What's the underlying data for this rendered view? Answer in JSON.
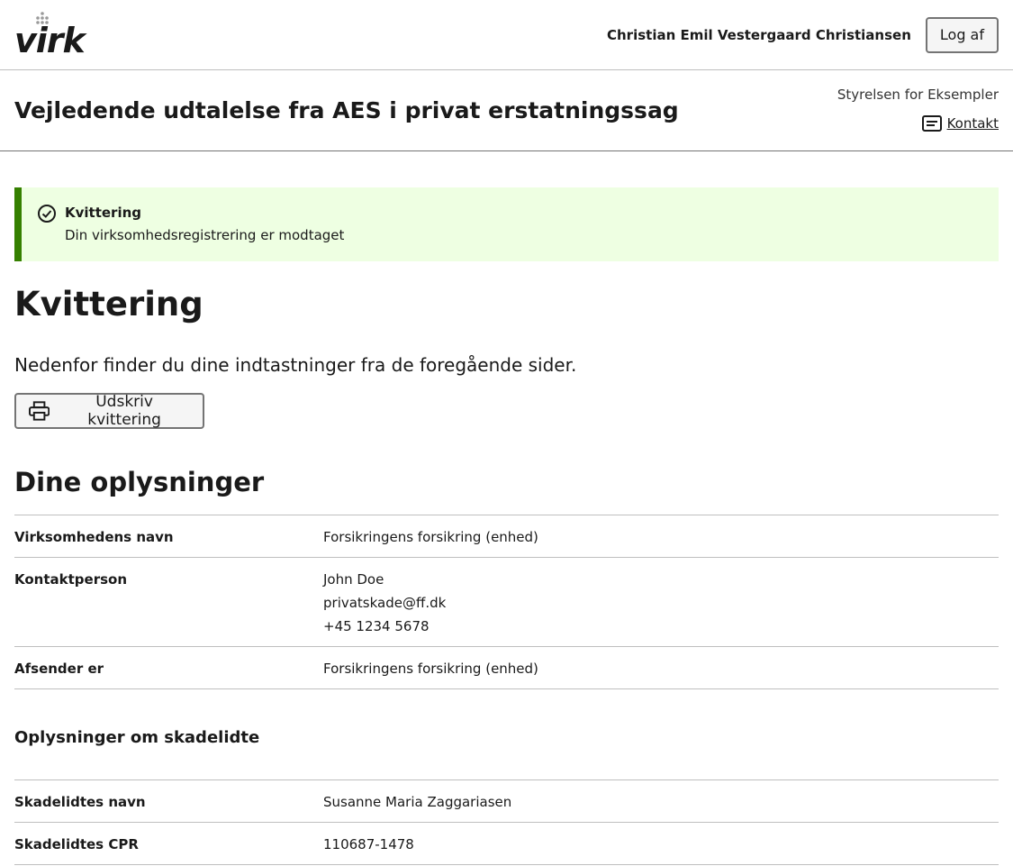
{
  "header": {
    "logo_text": "virk",
    "user_name": "Christian Emil Vestergaard Christiansen",
    "logout_label": "Log af"
  },
  "service": {
    "title": "Vejledende udtalelse fra AES i privat erstatningssag",
    "authority": "Styrelsen for Eksempler",
    "contact_label": "Kontakt"
  },
  "alert": {
    "title": "Kvittering",
    "text": "Din virksomhedsregistrering er modtaget",
    "color": "#358000"
  },
  "page": {
    "title": "Kvittering",
    "lead": "Nedenfor finder du dine indtastninger fra de foregående sider.",
    "print_label": "Udskriv kvittering"
  },
  "section1": {
    "title": "Dine oplysninger",
    "rows": [
      {
        "key": "Virksomhedens navn",
        "values": [
          "Forsikringens forsikring (enhed)"
        ]
      },
      {
        "key": "Kontaktperson",
        "values": [
          "John Doe",
          "privatskade@ff.dk",
          "+45 1234 5678"
        ]
      },
      {
        "key": "Afsender er",
        "values": [
          "Forsikringens forsikring (enhed)"
        ]
      }
    ]
  },
  "section2": {
    "title": "Oplysninger om skadelidte",
    "rows": [
      {
        "key": "Skadelidtes navn",
        "values": [
          "Susanne Maria Zaggariasen"
        ]
      },
      {
        "key": "Skadelidtes CPR",
        "values": [
          "110687-1478"
        ]
      }
    ]
  }
}
